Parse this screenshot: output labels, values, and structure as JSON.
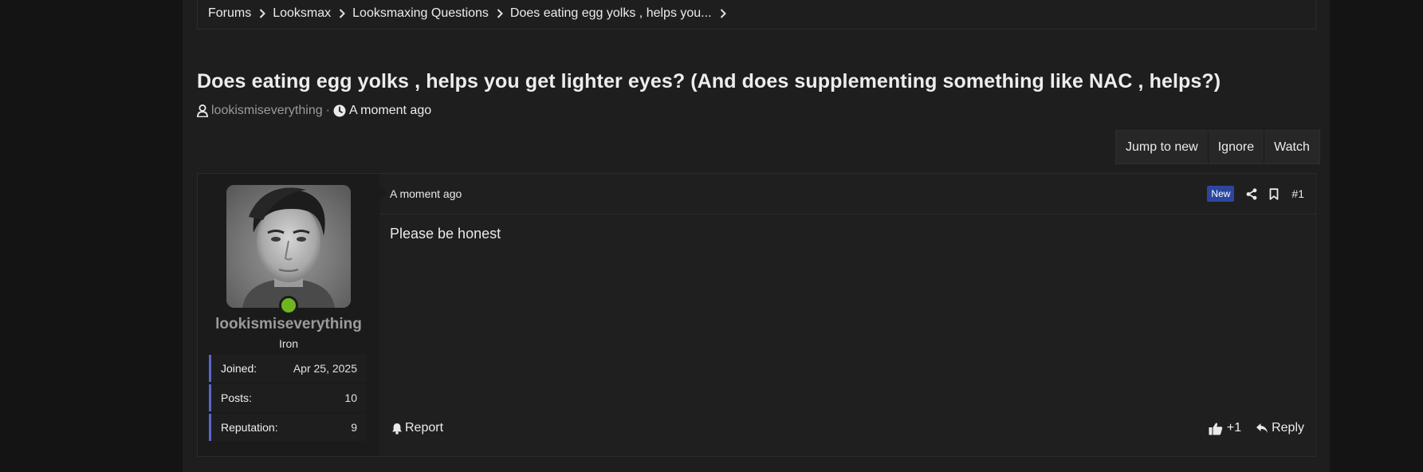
{
  "breadcrumb": [
    {
      "label": "Forums"
    },
    {
      "label": "Looksmax"
    },
    {
      "label": "Looksmaxing Questions"
    },
    {
      "label": "Does eating egg yolks , helps you..."
    }
  ],
  "thread": {
    "title": "Does eating egg yolks , helps you get lighter eyes? (And does supplementing something like NAC , helps?)",
    "author": "lookismiseverything",
    "separator": "·",
    "time": "A moment ago"
  },
  "actions": {
    "jump_to_new": "Jump to new",
    "ignore": "Ignore",
    "watch": "Watch"
  },
  "post": {
    "date": "A moment ago",
    "badge": "New",
    "number": "#1",
    "body": "Please be honest",
    "report": "Report",
    "likes": "+1",
    "reply": "Reply"
  },
  "user": {
    "name": "lookismiseverything",
    "title": "Iron",
    "online": true,
    "stats": [
      {
        "key": "Joined:",
        "value": "Apr 25, 2025"
      },
      {
        "key": "Posts:",
        "value": "10"
      },
      {
        "key": "Reputation:",
        "value": "9"
      }
    ]
  },
  "colors": {
    "accent_stat_border": "#5a67c9",
    "badge_new": "#2c46a0",
    "online": "#6fb520"
  },
  "icons": [
    "chevron-right-icon",
    "user-icon",
    "clock-icon",
    "share-icon",
    "bookmark-icon",
    "bell-icon",
    "thumbs-up-icon",
    "reply-icon"
  ]
}
